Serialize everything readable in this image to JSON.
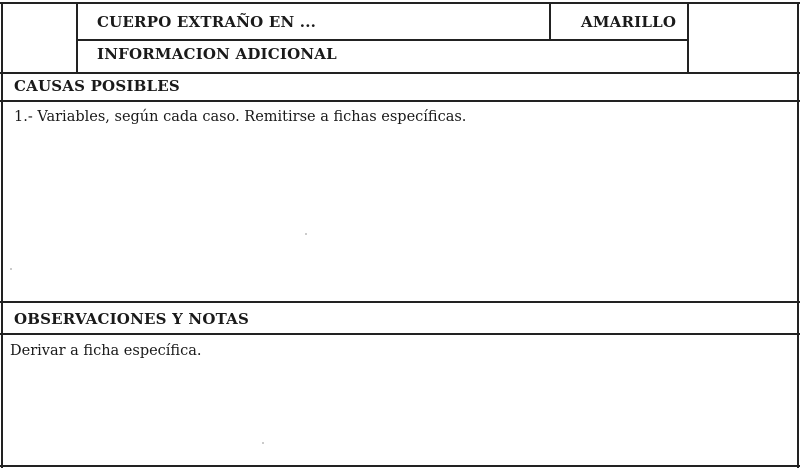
{
  "header": {
    "title": "CUERPO EXTRAÑO EN ...",
    "color_label": "AMARILLO",
    "subtitle": "INFORMACION ADICIONAL"
  },
  "causes": {
    "heading": "CAUSAS POSIBLES",
    "items": [
      "1.- Variables, según cada caso. Remitirse a fichas específicas."
    ]
  },
  "notes": {
    "heading": "OBSERVACIONES Y NOTAS",
    "text": "Derivar a ficha específica."
  },
  "colors": {
    "ink": "#1a1a1a",
    "rule": "#222222",
    "paper": "#ffffff"
  }
}
